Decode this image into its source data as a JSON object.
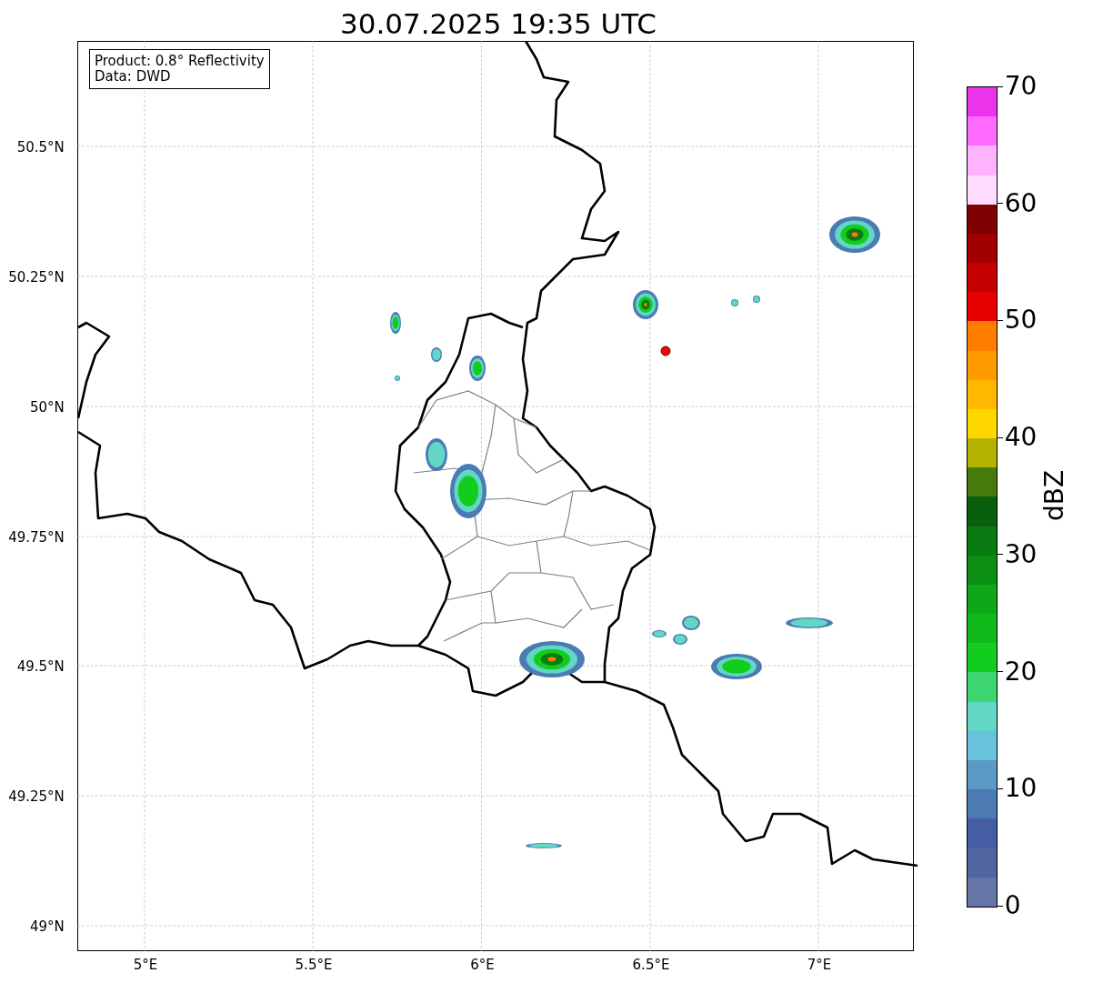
{
  "title": "30.07.2025 19:35 UTC",
  "info_box": [
    "Product: 0.8° Reflectivity",
    "Data: DWD"
  ],
  "x_ticks": [
    "5°E",
    "5.5°E",
    "6°E",
    "6.5°E",
    "7°E"
  ],
  "y_ticks": [
    "50.5°N",
    "50.25°N",
    "50°N",
    "49.75°N",
    "49.5°N",
    "49.25°N",
    "49°N"
  ],
  "colorbar": {
    "label": "dBZ",
    "ticks": [
      "70",
      "60",
      "50",
      "40",
      "30",
      "20",
      "10",
      "0"
    ],
    "bands": [
      {
        "color": "#ea33ea"
      },
      {
        "color": "#ff6aff"
      },
      {
        "color": "#ffb3ff"
      },
      {
        "color": "#ffdcff"
      },
      {
        "color": "#7f0000"
      },
      {
        "color": "#a20000"
      },
      {
        "color": "#c40000"
      },
      {
        "color": "#e60000"
      },
      {
        "color": "#ff7e00"
      },
      {
        "color": "#ff9a00"
      },
      {
        "color": "#ffb700"
      },
      {
        "color": "#ffd700"
      },
      {
        "color": "#b3b200"
      },
      {
        "color": "#467a0a"
      },
      {
        "color": "#085f0d"
      },
      {
        "color": "#0a7a12"
      },
      {
        "color": "#0c8f14"
      },
      {
        "color": "#0fa717"
      },
      {
        "color": "#10ba1a"
      },
      {
        "color": "#12cc1e"
      },
      {
        "color": "#3cd570"
      },
      {
        "color": "#62d7c6"
      },
      {
        "color": "#68c2dc"
      },
      {
        "color": "#5a9bc6"
      },
      {
        "color": "#4b7bb2"
      },
      {
        "color": "#445da3"
      },
      {
        "color": "#5066a0"
      },
      {
        "color": "#6575a5"
      }
    ]
  }
}
